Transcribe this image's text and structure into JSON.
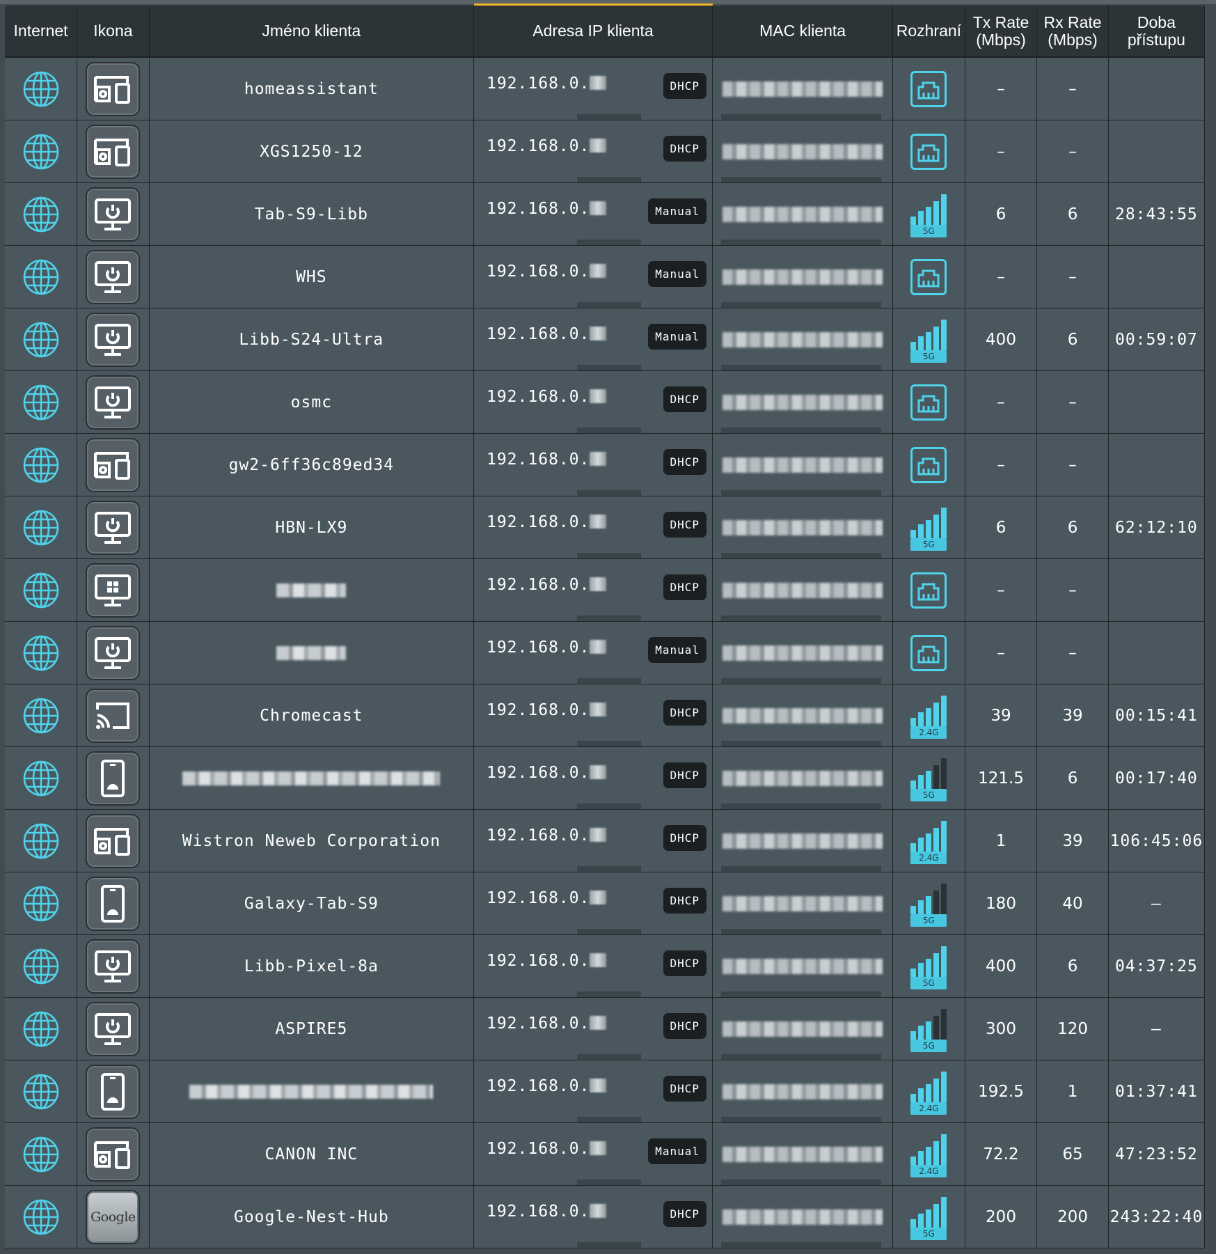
{
  "colors": {
    "accent": "#f0b429",
    "icon_cyan": "#4fd3ea",
    "header_bg": "#2c3438",
    "row_bg": "#4a575e"
  },
  "headers": {
    "internet": "Internet",
    "icon": "Ikona",
    "name": "Jméno klienta",
    "ip": "Adresa IP klienta",
    "mac": "MAC klienta",
    "iface": "Rozhraní",
    "tx_line1": "Tx Rate",
    "tx_line2": "(Mbps)",
    "rx_line1": "Rx Rate",
    "rx_line2": "(Mbps)",
    "time_line1": "Doba",
    "time_line2": "přístupu"
  },
  "rows": [
    {
      "device_icon": "iot-device-icon",
      "name": "homeassistant",
      "ip": "192.168.0.",
      "ip_type": "DHCP",
      "iface": "ethernet",
      "band": "",
      "tx": "–",
      "rx": "–",
      "time": ""
    },
    {
      "device_icon": "iot-device-icon",
      "name": "XGS1250-12",
      "ip": "192.168.0.",
      "ip_type": "DHCP",
      "iface": "ethernet",
      "band": "",
      "tx": "–",
      "rx": "–",
      "time": ""
    },
    {
      "device_icon": "computer-icon",
      "name": "Tab-S9-Libb",
      "ip": "192.168.0.",
      "ip_type": "Manual",
      "iface": "wifi",
      "band": "5G",
      "tx": "6",
      "rx": "6",
      "time": "28:43:55"
    },
    {
      "device_icon": "computer-icon",
      "name": "WHS",
      "ip": "192.168.0.",
      "ip_type": "Manual",
      "iface": "ethernet",
      "band": "",
      "tx": "–",
      "rx": "–",
      "time": ""
    },
    {
      "device_icon": "computer-icon",
      "name": "Libb-S24-Ultra",
      "ip": "192.168.0.",
      "ip_type": "Manual",
      "iface": "wifi",
      "band": "5G",
      "tx": "400",
      "rx": "6",
      "time": "00:59:07"
    },
    {
      "device_icon": "computer-icon",
      "name": "osmc",
      "ip": "192.168.0.",
      "ip_type": "DHCP",
      "iface": "ethernet",
      "band": "",
      "tx": "–",
      "rx": "–",
      "time": ""
    },
    {
      "device_icon": "iot-device-icon",
      "name": "gw2-6ff36c89ed34",
      "ip": "192.168.0.",
      "ip_type": "DHCP",
      "iface": "ethernet",
      "band": "",
      "tx": "–",
      "rx": "–",
      "time": ""
    },
    {
      "device_icon": "computer-icon",
      "name": "HBN-LX9",
      "ip": "192.168.0.",
      "ip_type": "DHCP",
      "iface": "wifi",
      "band": "5G",
      "tx": "6",
      "rx": "6",
      "time": "62:12:10"
    },
    {
      "device_icon": "windows-computer-icon",
      "name": "",
      "ip": "192.168.0.",
      "ip_type": "DHCP",
      "iface": "ethernet",
      "band": "",
      "tx": "–",
      "rx": "–",
      "time": ""
    },
    {
      "device_icon": "computer-icon",
      "name": "",
      "ip": "192.168.0.",
      "ip_type": "Manual",
      "iface": "ethernet",
      "band": "",
      "tx": "–",
      "rx": "–",
      "time": ""
    },
    {
      "device_icon": "cast-icon",
      "name": "Chromecast",
      "ip": "192.168.0.",
      "ip_type": "DHCP",
      "iface": "wifi",
      "band": "2.4G",
      "tx": "39",
      "rx": "39",
      "time": "00:15:41"
    },
    {
      "device_icon": "android-phone-icon",
      "name": "",
      "ip": "192.168.0.",
      "ip_type": "DHCP",
      "iface": "wifi",
      "band": "5G",
      "tx": "121.5",
      "rx": "6",
      "time": "00:17:40"
    },
    {
      "device_icon": "iot-device-icon",
      "name": "Wistron Neweb Corporation",
      "ip": "192.168.0.",
      "ip_type": "DHCP",
      "iface": "wifi",
      "band": "2.4G",
      "tx": "1",
      "rx": "39",
      "time": "106:45:06"
    },
    {
      "device_icon": "android-phone-icon",
      "name": "Galaxy-Tab-S9",
      "ip": "192.168.0.",
      "ip_type": "DHCP",
      "iface": "wifi",
      "band": "5G",
      "tx": "180",
      "rx": "40",
      "time": "–"
    },
    {
      "device_icon": "computer-icon",
      "name": "Libb-Pixel-8a",
      "ip": "192.168.0.",
      "ip_type": "DHCP",
      "iface": "wifi",
      "band": "5G",
      "tx": "400",
      "rx": "6",
      "time": "04:37:25"
    },
    {
      "device_icon": "computer-icon",
      "name": "ASPIRE5",
      "ip": "192.168.0.",
      "ip_type": "DHCP",
      "iface": "wifi",
      "band": "5G",
      "tx": "300",
      "rx": "120",
      "time": "–"
    },
    {
      "device_icon": "android-phone-icon",
      "name": "",
      "ip": "192.168.0.",
      "ip_type": "DHCP",
      "iface": "wifi",
      "band": "2.4G",
      "tx": "192.5",
      "rx": "1",
      "time": "01:37:41"
    },
    {
      "device_icon": "iot-device-icon",
      "name": "CANON INC",
      "ip": "192.168.0.",
      "ip_type": "Manual",
      "iface": "wifi",
      "band": "2.4G",
      "tx": "72.2",
      "rx": "65",
      "time": "47:23:52"
    },
    {
      "device_icon": "google-logo-icon",
      "name": "Google-Nest-Hub",
      "ip": "192.168.0.",
      "ip_type": "DHCP",
      "iface": "wifi",
      "band": "5G",
      "tx": "200",
      "rx": "200",
      "time": "243:22:40",
      "logo_text": "Google"
    }
  ]
}
